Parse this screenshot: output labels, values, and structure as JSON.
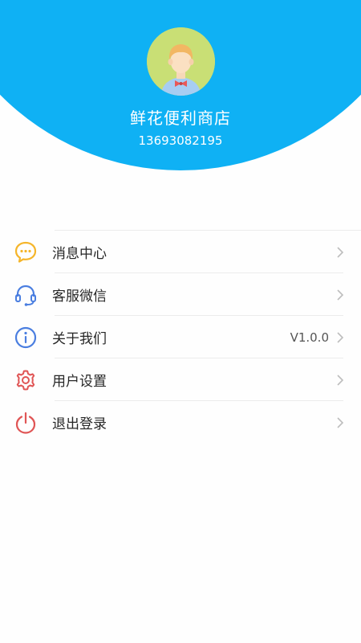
{
  "profile": {
    "shop_name": "鲜花便利商店",
    "phone": "13693082195"
  },
  "menu": [
    {
      "label": "消息中心",
      "value": "",
      "icon": "message-icon",
      "color": "#f5b52a"
    },
    {
      "label": "客服微信",
      "value": "",
      "icon": "headset-icon",
      "color": "#4a7ee0"
    },
    {
      "label": "关于我们",
      "value": "V1.0.0",
      "icon": "info-icon",
      "color": "#4a7ee0"
    },
    {
      "label": "用户设置",
      "value": "",
      "icon": "gear-icon",
      "color": "#e05555"
    },
    {
      "label": "退出登录",
      "value": "",
      "icon": "power-icon",
      "color": "#e05555"
    }
  ],
  "colors": {
    "header": "#0fb1f4",
    "chevron": "#bdbdbd"
  }
}
